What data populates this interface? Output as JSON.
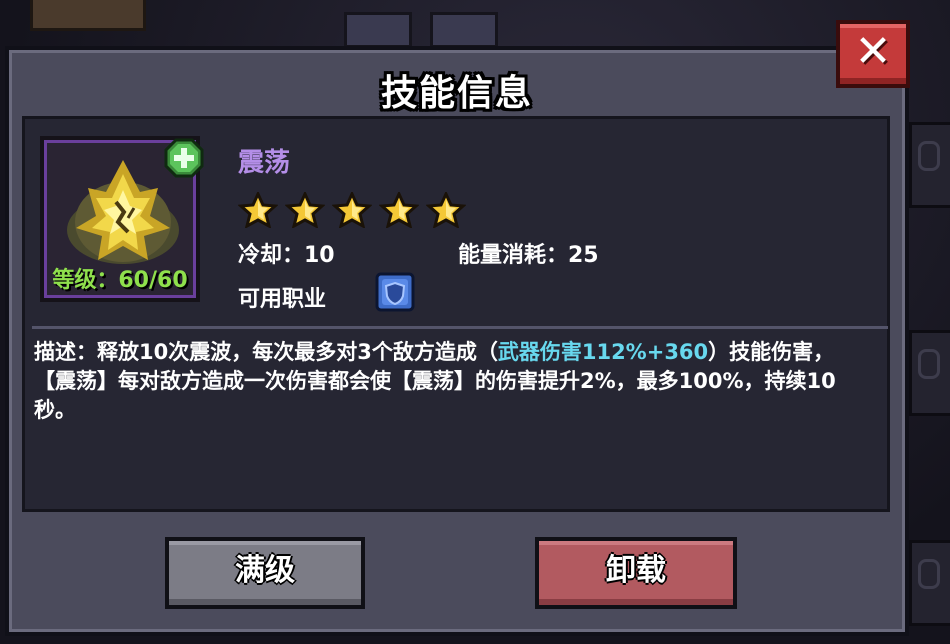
{
  "dialog": {
    "title": "技能信息",
    "close_label": "✕"
  },
  "skill": {
    "name": "震荡",
    "stars": 5,
    "level_label": "等级：60/60",
    "cooldown_label": "冷却：10",
    "energy_label": "能量消耗：25",
    "classes_label": "可用职业",
    "icon": "quake-skill-icon",
    "class_icon": "shield-class-icon",
    "badge_icon": "green-plus-badge-icon"
  },
  "description": {
    "prefix": "描述：释放10次震波，每次最多对3个敌方造成（",
    "highlight": "武器伤害112%+360",
    "suffix": "）技能伤害，【震荡】每对敌方造成一次伤害都会使【震荡】的伤害提升2%，最多100%，持续10秒。"
  },
  "buttons": {
    "max_level": "满级",
    "unload": "卸载"
  },
  "colors": {
    "skill_name": "#b48ee8",
    "highlight": "#68d8ee",
    "level": "#8fe04c",
    "close_button": "#c43a3a",
    "unload_button": "#b25a60",
    "max_button": "#7c7c86"
  }
}
